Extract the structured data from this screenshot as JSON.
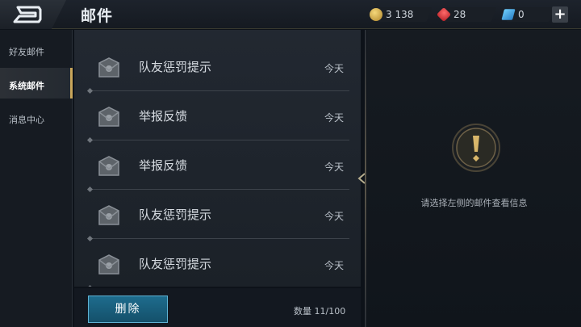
{
  "header": {
    "title": "邮件",
    "back_icon": "back-arrow-icon"
  },
  "resources": [
    {
      "name": "gold",
      "icon": "gold-coin-icon",
      "value": "3 138"
    },
    {
      "name": "gem",
      "icon": "red-gem-icon",
      "value": "28"
    },
    {
      "name": "coupon",
      "icon": "blue-coupon-icon",
      "value": "0"
    }
  ],
  "add_label": "+",
  "sidebar": {
    "items": [
      {
        "label": "好友邮件"
      },
      {
        "label": "系统邮件",
        "active": true
      },
      {
        "label": "消息中心"
      }
    ]
  },
  "mails": [
    {
      "title": "队友惩罚提示",
      "date": "今天"
    },
    {
      "title": "举报反馈",
      "date": "今天"
    },
    {
      "title": "举报反馈",
      "date": "今天"
    },
    {
      "title": "队友惩罚提示",
      "date": "今天"
    },
    {
      "title": "队友惩罚提示",
      "date": "今天"
    }
  ],
  "footer": {
    "delete_label": "删除",
    "count": "数量 11/100"
  },
  "detail": {
    "hint": "请选择左侧的邮件查看信息"
  },
  "colors": {
    "accent": "#c9a65b",
    "delete_button": "#1e6c8d"
  }
}
